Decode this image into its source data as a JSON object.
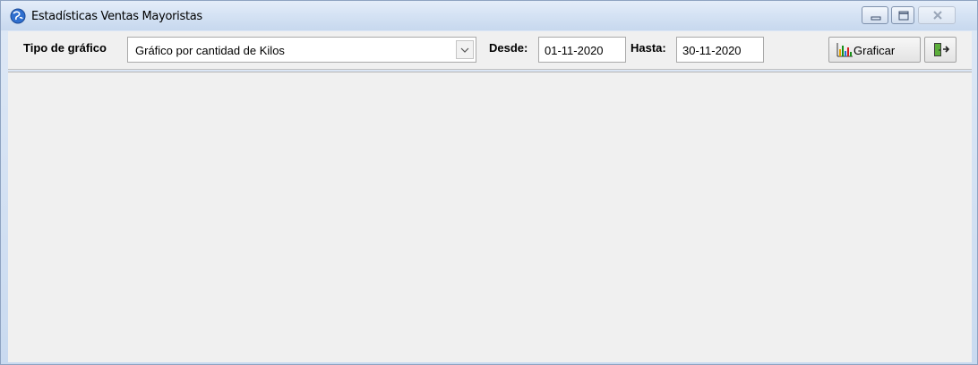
{
  "window": {
    "title": "Estadísticas Ventas Mayoristas"
  },
  "toolbar": {
    "chart_type_label": "Tipo de gráfico",
    "chart_type_value": "Gráfico por cantidad de Kilos",
    "from_label": "Desde:",
    "from_value": "01-11-2020",
    "to_label": "Hasta:",
    "to_value": "30-11-2020",
    "plot_button_label": "Graficar"
  },
  "icons": {
    "app": "globe-icon",
    "plot": "bar-chart-icon",
    "exit": "exit-door-icon",
    "dropdown": "chevron-down-icon"
  },
  "colors": {
    "titlebar": "#d3e1f3",
    "panel": "#f0f0f0",
    "accent_green": "#1a8f1a"
  }
}
